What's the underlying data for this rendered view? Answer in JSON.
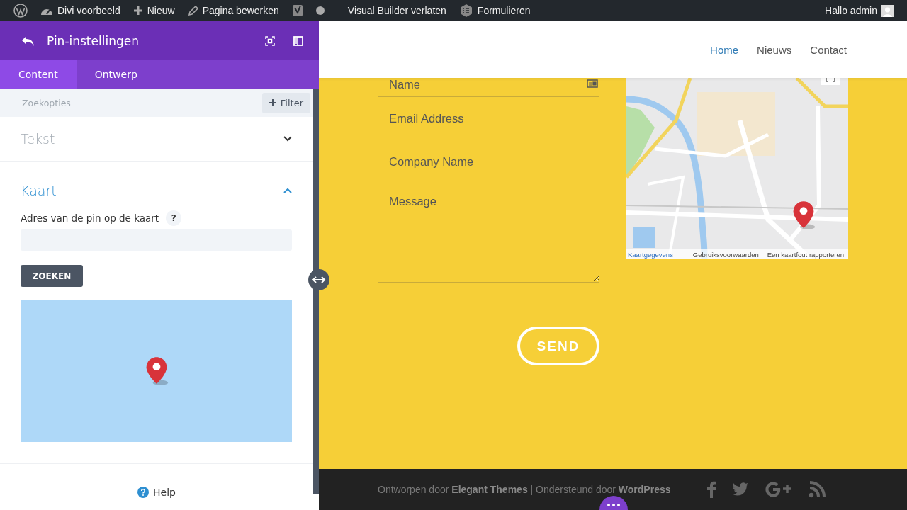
{
  "admin_bar": {
    "items": [
      {
        "kind": "wp-logo"
      },
      {
        "kind": "site",
        "label": "Divi voorbeeld"
      },
      {
        "kind": "new",
        "label": "Nieuw"
      },
      {
        "kind": "edit",
        "label": "Pagina bewerken"
      },
      {
        "kind": "yoast"
      },
      {
        "kind": "status-dot"
      },
      {
        "kind": "text",
        "label": "Visual Builder verlaten"
      },
      {
        "kind": "forms",
        "label": "Formulieren"
      }
    ],
    "greeting": "Hallo admin"
  },
  "panel": {
    "title": "Pin-instellingen",
    "tabs": [
      {
        "label": "Content",
        "selected": true
      },
      {
        "label": "Ontwerp",
        "selected": false
      }
    ],
    "search": {
      "placeholder": "Zoekopties"
    },
    "filter_button": "Filter",
    "sections": [
      {
        "title": "Tekst",
        "expanded": false
      },
      {
        "title": "Kaart",
        "expanded": true
      }
    ],
    "address_label": "Adres van de pin op de kaart",
    "help_badge": "?",
    "search_button": "ZOEKEN",
    "help": "Help"
  },
  "site": {
    "nav": [
      {
        "label": "Home",
        "selected": true
      },
      {
        "label": "Nieuws",
        "selected": false
      },
      {
        "label": "Contact",
        "selected": false
      }
    ],
    "fields": [
      {
        "placeholder": "Name"
      },
      {
        "placeholder": "Email Address"
      },
      {
        "placeholder": "Company Name"
      }
    ],
    "message": {
      "placeholder": "Message"
    },
    "send_button": "SEND",
    "map_links": [
      "Kaartgegevens",
      "Gebruiksvoorwaarden",
      "Een kaartfout rapporteren"
    ],
    "footer_text": "Ontworpen door **Elegant Themes** | Ondersteund door **WordPress**",
    "social": [
      {
        "kind": "facebook"
      },
      {
        "kind": "twitter"
      },
      {
        "kind": "google-plus"
      },
      {
        "kind": "rss"
      }
    ]
  }
}
